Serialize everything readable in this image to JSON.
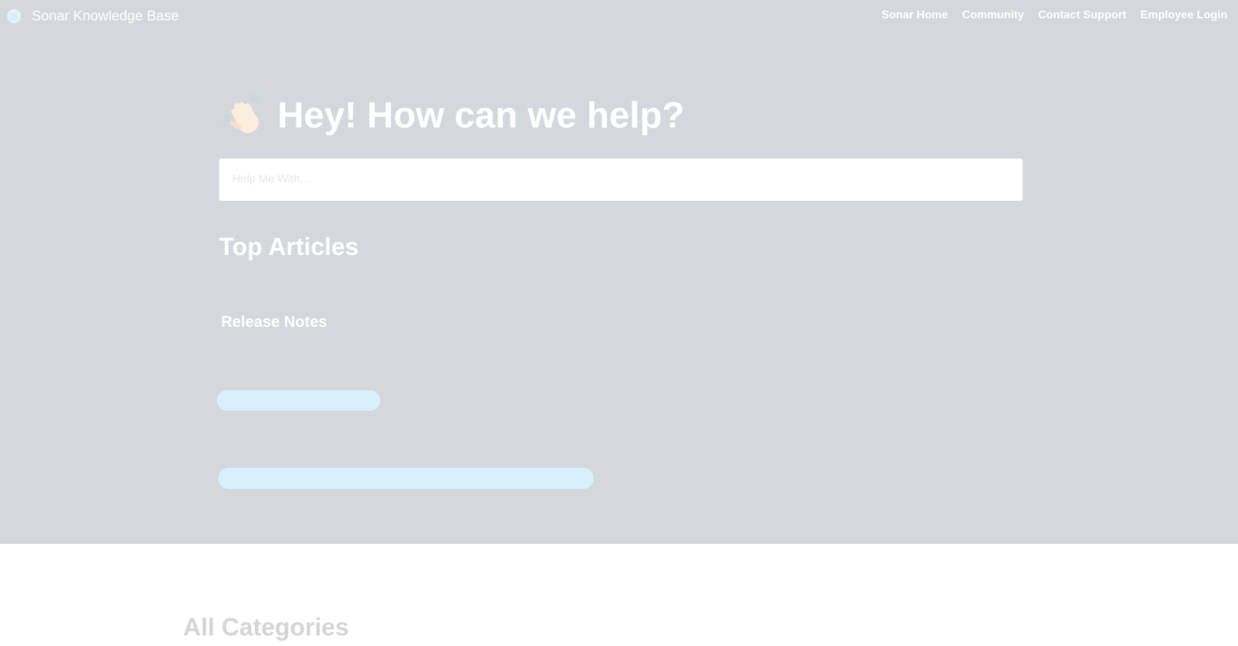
{
  "navbar": {
    "brand": "Sonar Knowledge Base",
    "links": [
      {
        "label": "Sonar Home"
      },
      {
        "label": "Community"
      },
      {
        "label": "Contact Support"
      },
      {
        "label": "Employee Login"
      }
    ]
  },
  "hero": {
    "icon": "waving-hand-icon",
    "headline": "Hey! How can we help?",
    "search": {
      "placeholder": "Help Me With...",
      "value": ""
    }
  },
  "top_articles": {
    "title": "Top Articles",
    "groups": [
      {
        "title": "Release Notes"
      }
    ]
  },
  "categories": {
    "title": "All Categories"
  },
  "colors": {
    "hero_background": "#d4d8dc",
    "skeleton": "#d8f0fb",
    "muted_heading": "#d4d5d6"
  }
}
